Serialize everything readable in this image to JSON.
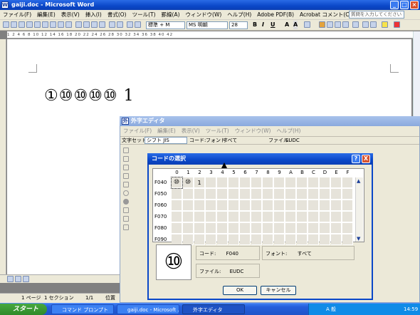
{
  "word": {
    "title": "gaiji.doc - Microsoft Word",
    "menu": [
      "ファイル(F)",
      "編集(E)",
      "表示(V)",
      "挿入(I)",
      "書式(O)",
      "ツール(T)",
      "罫線(A)",
      "ウィンドウ(W)",
      "ヘルプ(H)",
      "Adobe PDF(B)",
      "Acrobat コメント(C)"
    ],
    "help_placeholder": "質問を入力してください",
    "style_value": "標準 + M",
    "font_value": "MS 明朝",
    "size_value": "28",
    "format_labels": [
      "B",
      "I",
      "U",
      "A",
      "A"
    ],
    "document_text": "①⑩⑩⑩⑩ 1",
    "ruler": "1 2 4 6 8 10 12 14 16 18 20 22 24 26 28 30 32 34 36 38 40 42",
    "status": {
      "page": "1 ページ",
      "section": "1 セクション",
      "pages": "1/1",
      "position": "位置"
    }
  },
  "gaiji_editor": {
    "title": "外字エディタ",
    "menu": [
      "ファイル(F)",
      "編集(E)",
      "表示(V)",
      "ツール(T)",
      "ウィンドウ(W)",
      "ヘルプ(H)"
    ],
    "charset_label": "文字セット:",
    "charset_value": "シフト JIS",
    "code_label": "コード:",
    "font_label": "フォント:",
    "font_value": "すべて",
    "file_label": "ファイル:",
    "file_value": "EUDC"
  },
  "code_dialog": {
    "title": "コードの選択",
    "help_label": "?",
    "close_label": "X",
    "columns": [
      "0",
      "1",
      "2",
      "3",
      "4",
      "5",
      "6",
      "7",
      "8",
      "9",
      "A",
      "B",
      "C",
      "D",
      "E",
      "F"
    ],
    "rows": [
      "F040",
      "F050",
      "F060",
      "F070",
      "F080",
      "F090"
    ],
    "filled_cells": [
      "⑩",
      "⑩",
      "1"
    ],
    "preview_char": "⑩",
    "code_label": "コード:",
    "code_value": "F040",
    "font_label": "フォント:",
    "font_value": "すべて",
    "file_label": "ファイル:",
    "file_value": "EUDC",
    "ok_label": "OK",
    "cancel_label": "キャンセル"
  },
  "taskbar": {
    "start_label": "スタート",
    "tasks": [
      "コマンド プロンプト",
      "gaiji.doc - Microsoft ...",
      "外字エディタ"
    ],
    "tray_ime": "A 般",
    "clock": "14:59"
  }
}
